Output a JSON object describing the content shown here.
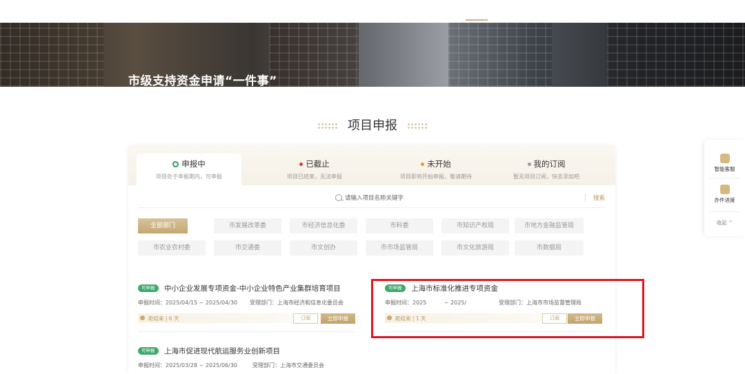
{
  "banner": {
    "title": "市级支持资金申请“一件事”"
  },
  "section": {
    "title": "项目申报"
  },
  "tabs": [
    {
      "label": "申报中",
      "desc": "项目处于申报期内，可申报",
      "color": "#2e9b5b"
    },
    {
      "label": "已截止",
      "desc": "项目已结束，无法申报",
      "color": "#e0353c"
    },
    {
      "label": "未开始",
      "desc": "项目即将开始申报，敬请期待",
      "color": "#e89a2c"
    },
    {
      "label": "我的订阅",
      "desc": "暂无项目订阅，快去添加吧",
      "color": "#999999"
    }
  ],
  "search": {
    "placeholder": "请输入项目名称关键字",
    "button": "搜索"
  },
  "departments": [
    "全部部门",
    "市发展改革委",
    "市经济信息化委",
    "市科委",
    "市知识产权局",
    "市地方金融监管局",
    "市农业农村委",
    "市交通委",
    "市文创办",
    "市市场监管局",
    "市文化旅游局",
    "市数据局"
  ],
  "cards": [
    {
      "badge": "可申报",
      "title": "中小企业发展专项资金-中小企业特色产业集群培育项目",
      "time": "申报时间：2025/04/15 ~ 2025/04/30",
      "dept": "受理部门：上海市经济和信息化委员会",
      "status": "距结束 | 6 天",
      "subscribe": "订阅",
      "apply": "立即申报"
    },
    {
      "badge": "可申报",
      "title": "上海市标准化推进专项资金",
      "time": "申报时间：2025          ~ 2025/",
      "dept": "受理部门：上海市市场监督管理局",
      "status": "距结束 | 1 天",
      "subscribe": "订阅",
      "apply": "立即申报"
    },
    {
      "badge": "可申报",
      "title": "上海市促进现代航运服务业创新项目",
      "time": "申报时间：2025/03/28 ~ 2025/06/30",
      "dept": "受理部门：上海市交通委员会"
    }
  ],
  "float": {
    "service": "智能客服",
    "progress": "办件进度",
    "collapse": "收起 ^"
  },
  "colors": {
    "accent": "#c5a872",
    "badge": "#3fa86b",
    "highlight": "#e0141e"
  }
}
